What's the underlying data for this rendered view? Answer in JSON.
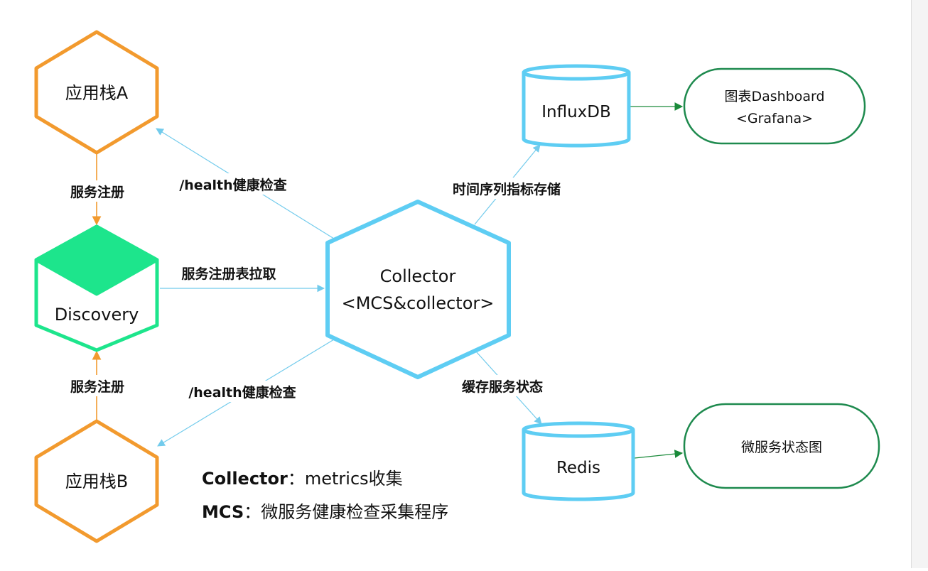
{
  "diagram": {
    "nodes": {
      "app_stack_a": "应用栈A",
      "app_stack_b": "应用栈B",
      "discovery": "Discovery",
      "collector_line1": "Collector",
      "collector_line2": "<MCS&collector>",
      "influxdb": "InfluxDB",
      "redis": "Redis",
      "dashboard_line1": "图表Dashboard",
      "dashboard_line2": "<Grafana>",
      "status_graph": "微服务状态图"
    },
    "edges": {
      "register_top": "服务注册",
      "register_bottom": "服务注册",
      "health_check_a": "/health健康检查",
      "health_check_b": "/health健康检查",
      "pull_registry": "服务注册表拉取",
      "timeseries_store": "时间序列指标存储",
      "cache_status": "缓存服务状态"
    },
    "legend": [
      {
        "term": "Collector",
        "sep": "：",
        "desc": "metrics收集"
      },
      {
        "term": "MCS",
        "sep": "：",
        "desc": "微服务健康检查采集程序"
      }
    ],
    "colors": {
      "app_stack": "#f29a2e",
      "discovery": "#1de58c",
      "collector": "#5ecdf3",
      "edge_blue": "#72cbec",
      "edge_orange": "#f29a2e",
      "edge_green": "#1a8a3a",
      "dashboard_border": "#1e8a4e"
    }
  }
}
